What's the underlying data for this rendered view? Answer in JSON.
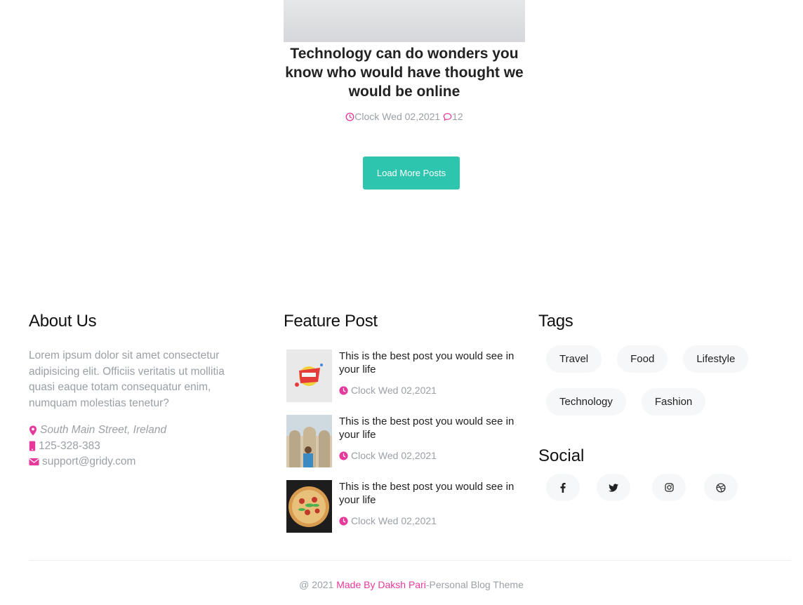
{
  "post": {
    "title": "Technology can do wonders you know who would have thought we would be online",
    "date": "Clock Wed 02,2021",
    "comments": "12"
  },
  "load_more": {
    "label": "Load More Posts"
  },
  "about": {
    "heading": "About Us",
    "text": "Lorem ipsum dolor sit amet consectetur adipisicing elit. Officiis veritatis ut mollitia quasi eaque totam consequatur enim, numquam molestias tenetur?",
    "address": "South Main Street, Ireland",
    "phone": "125-328-383",
    "email": "support@gridy.com"
  },
  "feature": {
    "heading": "Feature Post",
    "posts": [
      {
        "title": "This is the best post you would see in your life",
        "date": "Clock Wed 02,2021"
      },
      {
        "title": "This is the best post you would see in your life",
        "date": "Clock Wed 02,2021"
      },
      {
        "title": "This is the best post you would see in your life",
        "date": "Clock Wed 02,2021"
      }
    ]
  },
  "tags": {
    "heading": "Tags",
    "items": [
      "Travel",
      "Food",
      "Lifestyle",
      "Technology",
      "Fashion"
    ]
  },
  "social": {
    "heading": "Social",
    "icons": [
      "facebook-icon",
      "twitter-icon",
      "instagram-icon",
      "dribbble-icon"
    ]
  },
  "footer": {
    "prefix": "@ 2021",
    "link": "Made By Daksh Pari",
    "suffix": "-Personal Blog Theme"
  },
  "colors": {
    "accent": "#e6399b",
    "button": "#2dc5ad",
    "muted": "#9aa0a6"
  }
}
